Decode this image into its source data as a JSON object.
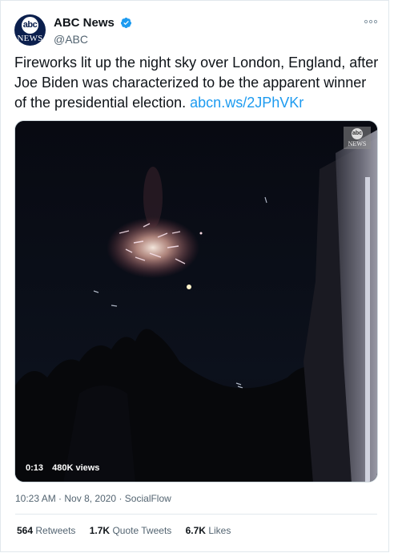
{
  "account": {
    "display_name": "ABC News",
    "handle": "@ABC",
    "avatar_top": "abc",
    "avatar_bottom": "NEWS",
    "verified": true
  },
  "tweet": {
    "text": "Fireworks lit up the night sky over London, England, after Joe Biden was characterized to be the apparent winner of the presidential election.",
    "link": "abcn.ws/2JPhVKr"
  },
  "media": {
    "watermark_top": "abc",
    "watermark_bottom": "NEWS",
    "duration": "0:13",
    "views": "480K views"
  },
  "meta": {
    "time": "10:23 AM",
    "date": "Nov 8, 2020",
    "source": "SocialFlow"
  },
  "stats": {
    "retweets_count": "564",
    "retweets_label": "Retweets",
    "quotes_count": "1.7K",
    "quotes_label": "Quote Tweets",
    "likes_count": "6.7K",
    "likes_label": "Likes"
  },
  "colors": {
    "link": "#1d9bf0",
    "verified": "#1d9bf0",
    "secondary_text": "#536471"
  },
  "icons": [
    "more-options-icon",
    "verified-badge-icon"
  ]
}
